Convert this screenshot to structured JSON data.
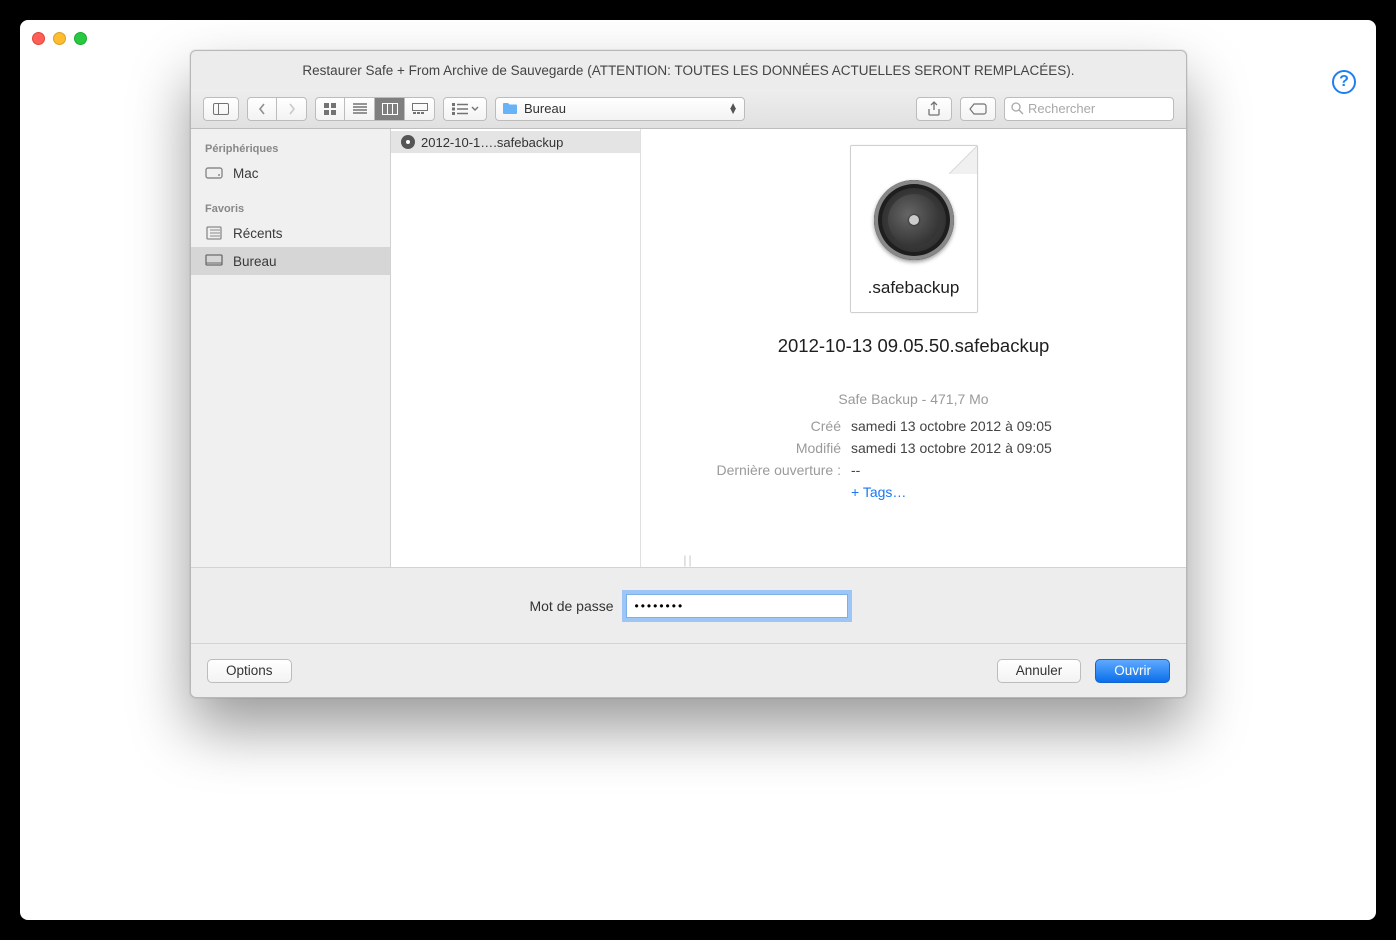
{
  "dialog": {
    "title": "Restaurer Safe + From Archive de Sauvegarde (ATTENTION: TOUTES LES DONNÉES ACTUELLES SERONT REMPLACÉES)."
  },
  "toolbar": {
    "location": "Bureau",
    "search_placeholder": "Rechercher"
  },
  "sidebar": {
    "devices_header": "Périphériques",
    "favorites_header": "Favoris",
    "items": {
      "mac": "Mac",
      "recents": "Récents",
      "desktop": "Bureau"
    }
  },
  "filelist": {
    "item0": "2012-10-1….safebackup"
  },
  "preview": {
    "ext": ".safebackup",
    "name": "2012-10-13 09.05.50.safebackup",
    "summary": "Safe Backup - 471,7 Mo",
    "created_key": "Créé",
    "created_val": "samedi 13 octobre 2012 à 09:05",
    "modified_key": "Modifié",
    "modified_val": "samedi 13 octobre 2012 à 09:05",
    "lastopen_key": "Dernière ouverture :",
    "lastopen_val": "--",
    "tags": "+ Tags…"
  },
  "password": {
    "label": "Mot de passe",
    "value": "••••••••"
  },
  "buttons": {
    "options": "Options",
    "cancel": "Annuler",
    "open": "Ouvrir"
  },
  "help": "?"
}
